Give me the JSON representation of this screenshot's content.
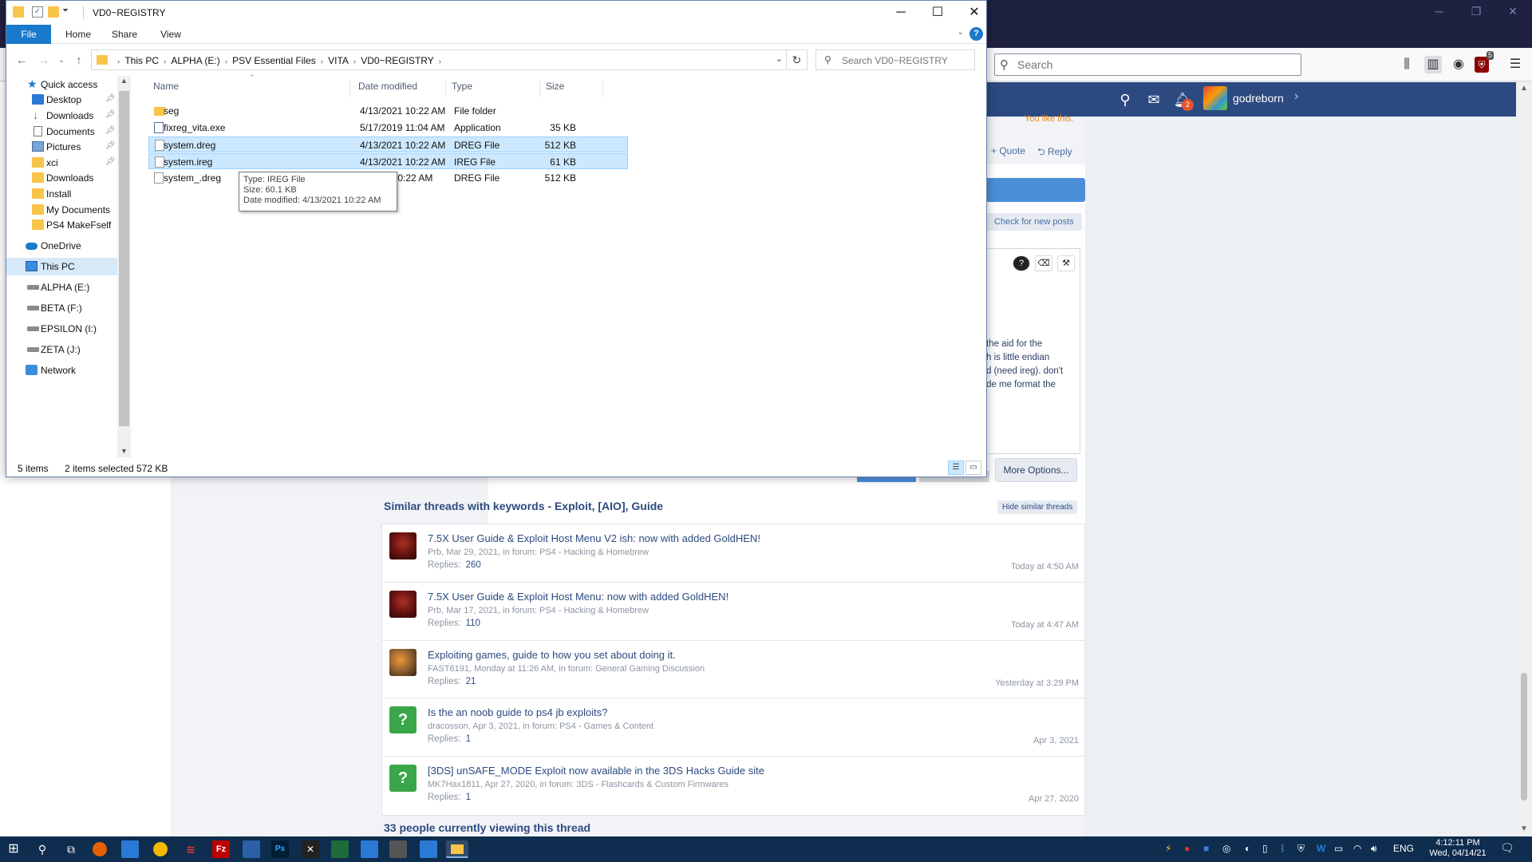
{
  "browser": {
    "search_placeholder": "Search",
    "ublock_count": "5",
    "user_name": "godreborn",
    "alert_count": "2",
    "you_like": "You like this.",
    "quote_label": "+ Quote",
    "reply_label": "Reply",
    "check_new_posts": "Check for new posts",
    "editor_text": [
      "the aid for the",
      "h is little endian",
      "d (need ireg).  don't",
      "de me format the"
    ],
    "more_options": "More Options...",
    "similar_title": "Similar threads with keywords - Exploit, [AIO], Guide",
    "hide_similar": "Hide similar threads",
    "threads": [
      {
        "title": "7.5X User Guide & Exploit Host Menu V2 ish: now with added GoldHEN!",
        "meta": "Prb, Mar 29, 2021, in forum: PS4 - Hacking & Homebrew",
        "replies_label": "Replies:",
        "replies": "260",
        "date": "Today at 4:50 AM"
      },
      {
        "title": "7.5X User Guide & Exploit Host Menu: now with added GoldHEN!",
        "meta": "Prb, Mar 17, 2021, in forum: PS4 - Hacking & Homebrew",
        "replies_label": "Replies:",
        "replies": "110",
        "date": "Today at 4:47 AM"
      },
      {
        "title": "Exploiting games, guide to how you set about doing it.",
        "meta": "FAST6191, Monday at 11:26 AM, in forum: General Gaming Discussion",
        "replies_label": "Replies:",
        "replies": "21",
        "date": "Yesterday at 3:29 PM"
      },
      {
        "title": "Is the an noob guide to ps4 jb exploits?",
        "meta": "dracosson, Apr 3, 2021, in forum: PS4 - Games & Content",
        "replies_label": "Replies:",
        "replies": "1",
        "date": "Apr 3, 2021"
      },
      {
        "title": "[3DS] unSAFE_MODE Exploit now available in the 3DS Hacks Guide site",
        "meta": "MK7Hax1811, Apr 27, 2020, in forum: 3DS - Flashcards & Custom Firmwares",
        "replies_label": "Replies:",
        "replies": "1",
        "date": "Apr 27, 2020"
      }
    ],
    "viewing": "33 people currently viewing this thread"
  },
  "explorer": {
    "title": "VD0~REGISTRY",
    "ribbon": {
      "file": "File",
      "home": "Home",
      "share": "Share",
      "view": "View",
      "help": "?"
    },
    "breadcrumbs": [
      "This PC",
      "ALPHA (E:)",
      "PSV Essential Files",
      "VITA",
      "VD0~REGISTRY"
    ],
    "search_placeholder": "Search VD0~REGISTRY",
    "nav": {
      "quick_access": "Quick access",
      "desktop": "Desktop",
      "downloads_pinned": "Downloads",
      "documents": "Documents",
      "pictures": "Pictures",
      "xci": "xci",
      "downloads": "Downloads",
      "install": "Install",
      "my_documents": "My Documents",
      "ps4_makefself": "PS4 MakeFself",
      "onedrive": "OneDrive",
      "this_pc": "This PC",
      "alpha": "ALPHA (E:)",
      "beta": "BETA (F:)",
      "epsilon": "EPSILON (I:)",
      "zeta": "ZETA (J:)",
      "network": "Network"
    },
    "columns": {
      "name": "Name",
      "date": "Date modified",
      "type": "Type",
      "size": "Size"
    },
    "files": [
      {
        "name": "seg",
        "date": "4/13/2021 10:22 AM",
        "type": "File folder",
        "size": ""
      },
      {
        "name": "fixreg_vita.exe",
        "date": "5/17/2019 11:04 AM",
        "type": "Application",
        "size": "35 KB"
      },
      {
        "name": "system.dreg",
        "date": "4/13/2021 10:22 AM",
        "type": "DREG File",
        "size": "512 KB"
      },
      {
        "name": "system.ireg",
        "date": "4/13/2021 10:22 AM",
        "type": "IREG File",
        "size": "61 KB"
      },
      {
        "name": "system_.dreg",
        "date": "21 10:22 AM",
        "type": "DREG File",
        "size": "512 KB"
      }
    ],
    "tooltip": {
      "type": "Type: IREG File",
      "size": "Size: 60.1 KB",
      "date": "Date modified: 4/13/2021 10:22 AM"
    },
    "status": {
      "items": "5 items",
      "selected": "2 items selected  572 KB"
    }
  },
  "taskbar": {
    "lang": "ENG",
    "time": "4:12:11 PM",
    "date": "Wed, 04/14/21"
  },
  "colors": {
    "accent": "#1979ca",
    "selection": "#cce8ff",
    "forum_nav": "#2d4a80",
    "taskbar": "#0f2d4e"
  }
}
